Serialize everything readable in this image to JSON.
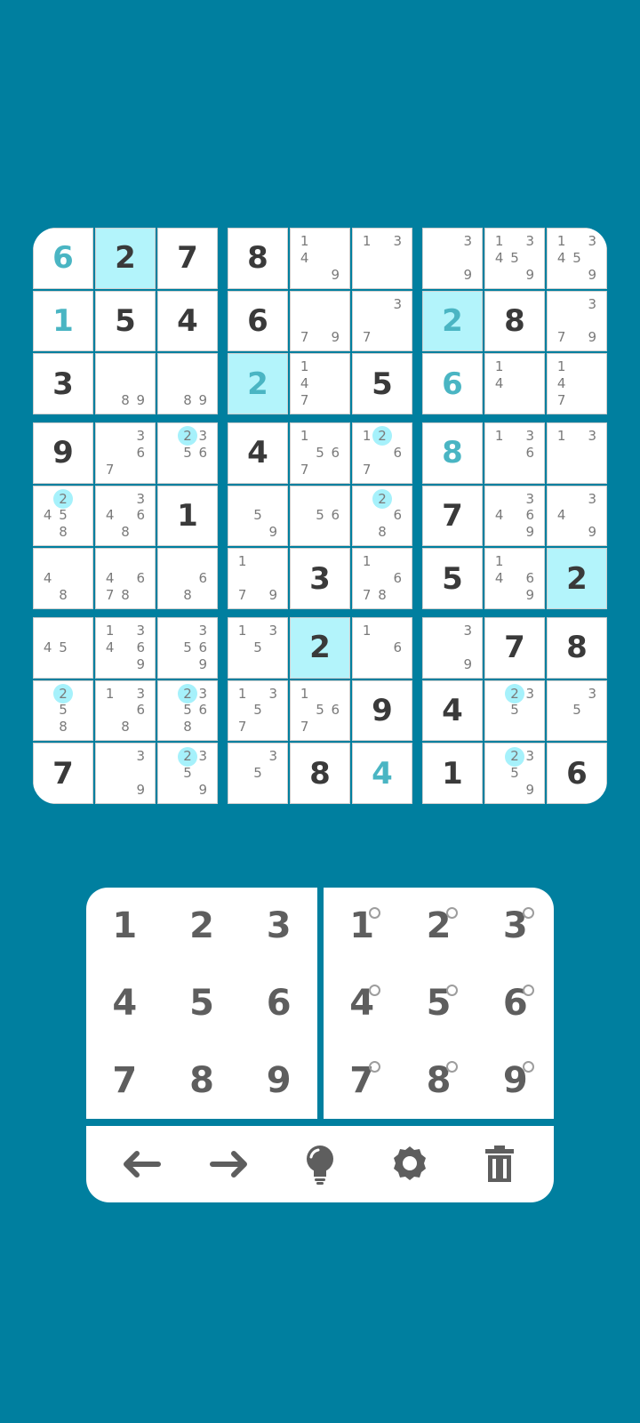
{
  "board": [
    [
      {
        "v": "6",
        "type": "user"
      },
      {
        "v": "2",
        "type": "given",
        "hl": true
      },
      {
        "v": "7",
        "type": "given"
      },
      {
        "v": "8",
        "type": "given"
      },
      {
        "notes": [
          "1",
          "4",
          "9"
        ]
      },
      {
        "notes": [
          "1",
          "3"
        ]
      },
      {
        "notes": [
          "3",
          "9"
        ]
      },
      {
        "notes": [
          "1",
          "3",
          "4",
          "5",
          "9"
        ]
      },
      {
        "notes": [
          "1",
          "3",
          "4",
          "5",
          "9"
        ]
      }
    ],
    [
      {
        "v": "1",
        "type": "user"
      },
      {
        "v": "5",
        "type": "given"
      },
      {
        "v": "4",
        "type": "given"
      },
      {
        "v": "6",
        "type": "given"
      },
      {
        "notes": [
          "7",
          "9"
        ]
      },
      {
        "notes": [
          "3",
          "7"
        ]
      },
      {
        "v": "2",
        "type": "user",
        "hl": true
      },
      {
        "v": "8",
        "type": "given"
      },
      {
        "notes": [
          "3",
          "7",
          "9"
        ]
      }
    ],
    [
      {
        "v": "3",
        "type": "given"
      },
      {
        "notes": [
          "8",
          "9"
        ]
      },
      {
        "notes": [
          "8",
          "9"
        ]
      },
      {
        "v": "2",
        "type": "user",
        "hl": true
      },
      {
        "notes": [
          "1",
          "4",
          "7"
        ]
      },
      {
        "v": "5",
        "type": "given"
      },
      {
        "v": "6",
        "type": "user"
      },
      {
        "notes": [
          "1",
          "4"
        ]
      },
      {
        "notes": [
          "1",
          "4",
          "7"
        ]
      }
    ],
    [
      {
        "v": "9",
        "type": "given"
      },
      {
        "notes": [
          "3",
          "6",
          "7"
        ]
      },
      {
        "notes": [
          "2",
          "3",
          "5",
          "6"
        ],
        "marked": [
          "2"
        ]
      },
      {
        "v": "4",
        "type": "given"
      },
      {
        "notes": [
          "1",
          "5",
          "6",
          "7"
        ]
      },
      {
        "notes": [
          "1",
          "2",
          "6",
          "7"
        ],
        "marked": [
          "2"
        ]
      },
      {
        "v": "8",
        "type": "user"
      },
      {
        "notes": [
          "1",
          "3",
          "6"
        ]
      },
      {
        "notes": [
          "1",
          "3"
        ]
      }
    ],
    [
      {
        "notes": [
          "2",
          "4",
          "5",
          "8"
        ],
        "marked": [
          "2"
        ]
      },
      {
        "notes": [
          "3",
          "4",
          "6",
          "8"
        ]
      },
      {
        "v": "1",
        "type": "given"
      },
      {
        "notes": [
          "5",
          "9"
        ]
      },
      {
        "notes": [
          "5",
          "6"
        ]
      },
      {
        "notes": [
          "2",
          "6",
          "8"
        ],
        "marked": [
          "2"
        ]
      },
      {
        "v": "7",
        "type": "given"
      },
      {
        "notes": [
          "3",
          "4",
          "6",
          "9"
        ]
      },
      {
        "notes": [
          "3",
          "4",
          "9"
        ]
      }
    ],
    [
      {
        "notes": [
          "4",
          "8"
        ]
      },
      {
        "notes": [
          "4",
          "6",
          "7",
          "8"
        ]
      },
      {
        "notes": [
          "6",
          "8"
        ]
      },
      {
        "notes": [
          "1",
          "7",
          "9"
        ]
      },
      {
        "v": "3",
        "type": "given"
      },
      {
        "notes": [
          "1",
          "6",
          "7",
          "8"
        ]
      },
      {
        "v": "5",
        "type": "given"
      },
      {
        "notes": [
          "1",
          "4",
          "6",
          "9"
        ]
      },
      {
        "v": "2",
        "type": "given",
        "hl": true
      }
    ],
    [
      {
        "notes": [
          "4",
          "5"
        ]
      },
      {
        "notes": [
          "1",
          "3",
          "4",
          "6",
          "9"
        ]
      },
      {
        "notes": [
          "3",
          "5",
          "6",
          "9"
        ]
      },
      {
        "notes": [
          "1",
          "3",
          "5"
        ]
      },
      {
        "v": "2",
        "type": "given",
        "hl": true
      },
      {
        "notes": [
          "1",
          "6"
        ]
      },
      {
        "notes": [
          "3",
          "9"
        ]
      },
      {
        "v": "7",
        "type": "given"
      },
      {
        "v": "8",
        "type": "given"
      }
    ],
    [
      {
        "notes": [
          "2",
          "5",
          "8"
        ],
        "marked": [
          "2"
        ]
      },
      {
        "notes": [
          "1",
          "3",
          "6",
          "8"
        ]
      },
      {
        "notes": [
          "2",
          "3",
          "5",
          "6",
          "8"
        ],
        "marked": [
          "2"
        ]
      },
      {
        "notes": [
          "1",
          "3",
          "5",
          "7"
        ]
      },
      {
        "notes": [
          "1",
          "5",
          "6",
          "7"
        ]
      },
      {
        "v": "9",
        "type": "given"
      },
      {
        "v": "4",
        "type": "given"
      },
      {
        "notes": [
          "2",
          "3",
          "5"
        ],
        "marked": [
          "2"
        ]
      },
      {
        "notes": [
          "3",
          "5"
        ]
      }
    ],
    [
      {
        "v": "7",
        "type": "given"
      },
      {
        "notes": [
          "3",
          "9"
        ]
      },
      {
        "notes": [
          "2",
          "3",
          "5",
          "9"
        ],
        "marked": [
          "2"
        ]
      },
      {
        "notes": [
          "3",
          "5"
        ]
      },
      {
        "v": "8",
        "type": "given"
      },
      {
        "v": "4",
        "type": "user"
      },
      {
        "v": "1",
        "type": "given"
      },
      {
        "notes": [
          "2",
          "3",
          "5",
          "9"
        ],
        "marked": [
          "2"
        ]
      },
      {
        "v": "6",
        "type": "given"
      }
    ]
  ],
  "keypad": {
    "digits": [
      "1",
      "2",
      "3",
      "4",
      "5",
      "6",
      "7",
      "8",
      "9"
    ],
    "note_digits": [
      "1",
      "2",
      "3",
      "4",
      "5",
      "6",
      "7",
      "8",
      "9"
    ]
  },
  "toolbar": [
    {
      "name": "undo",
      "icon": "arrow-left-icon"
    },
    {
      "name": "redo",
      "icon": "arrow-right-icon"
    },
    {
      "name": "hint",
      "icon": "lightbulb-icon"
    },
    {
      "name": "settings",
      "icon": "gear-icon"
    },
    {
      "name": "erase",
      "icon": "trash-icon"
    }
  ],
  "colors": {
    "background": "#007f9f",
    "highlight": "#b3f4fb",
    "user_digit": "#4ab5c3",
    "given_digit": "#3a3a3a",
    "note_mark": "#a6f1fb"
  }
}
